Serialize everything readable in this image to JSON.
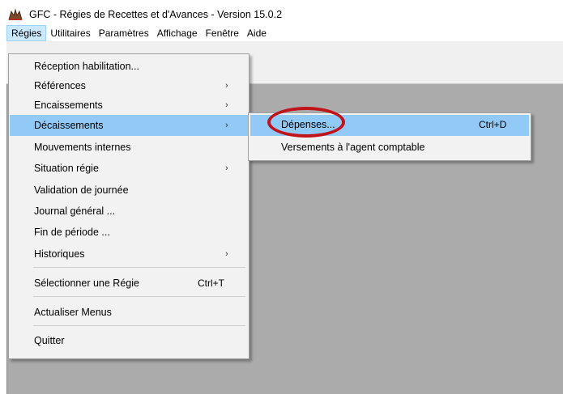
{
  "window": {
    "title": "GFC - Régies de Recettes et d'Avances - Version 15.0.2",
    "icon": "app-logo-icon"
  },
  "menubar": {
    "items": [
      "Régies",
      "Utilitaires",
      "Paramètres",
      "Affichage",
      "Fenêtre",
      "Aide"
    ]
  },
  "dropdown": {
    "items": [
      {
        "label": "Réception habilitation..."
      },
      {
        "label": "Références",
        "arrow": "›"
      },
      {
        "label": "Encaissements",
        "arrow": "›"
      },
      {
        "label": "Décaissements",
        "arrow": "›"
      },
      {
        "label": "Mouvements internes"
      },
      {
        "label": "Situation régie",
        "arrow": "›"
      },
      {
        "label": "Validation de journée"
      },
      {
        "label": "Journal général ..."
      },
      {
        "label": "Fin de période ..."
      },
      {
        "label": "Historiques",
        "arrow": "›"
      },
      {
        "label": "Sélectionner une Régie",
        "shortcut": "Ctrl+T"
      },
      {
        "label": "Actualiser Menus"
      },
      {
        "label": "Quitter"
      }
    ]
  },
  "submenu": {
    "items": [
      {
        "label": "Dépenses...",
        "shortcut": "Ctrl+D"
      },
      {
        "label": "Versements à l'agent comptable"
      }
    ]
  },
  "colors": {
    "highlight": "#91c9f7",
    "annotation": "#c0141b",
    "workspace": "#ababab"
  }
}
